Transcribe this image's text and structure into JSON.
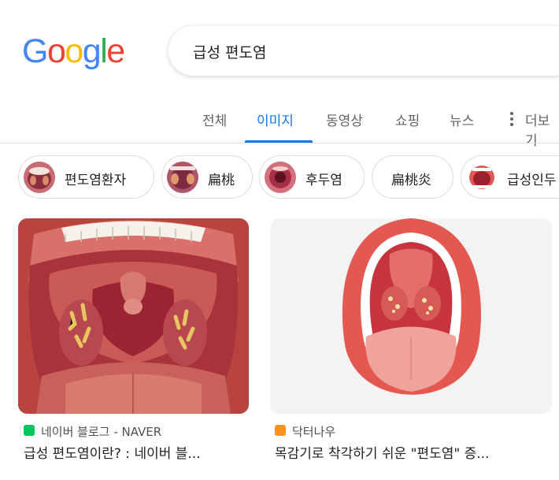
{
  "logo": {
    "letters": [
      "G",
      "o",
      "o",
      "g",
      "l",
      "e"
    ],
    "colors": [
      "#4285f4",
      "#ea4335",
      "#fbbc05",
      "#4285f4",
      "#34a853",
      "#ea4335"
    ]
  },
  "search": {
    "query": "급성 편도염"
  },
  "tabs": [
    {
      "label": "전체",
      "active": false
    },
    {
      "label": "이미지",
      "active": true
    },
    {
      "label": "동영상",
      "active": false
    },
    {
      "label": "쇼핑",
      "active": false
    },
    {
      "label": "뉴스",
      "active": false
    },
    {
      "label": "더보기",
      "active": false
    }
  ],
  "chips": [
    {
      "label": "편도염환자",
      "has_thumb": true
    },
    {
      "label": "扁桃",
      "has_thumb": true
    },
    {
      "label": "후두염",
      "has_thumb": true
    },
    {
      "label": "扁桃炎",
      "has_thumb": false
    },
    {
      "label": "급성인두",
      "has_thumb": true
    }
  ],
  "results": [
    {
      "source": "네이버 블로그 - NAVER",
      "source_icon": "naver-blog-icon",
      "source_color": "#03c75a",
      "title": "급성 편도염이란? : 네이버 블..."
    },
    {
      "source": "닥터나우",
      "source_icon": "doctornow-icon",
      "source_color": "#f7931e",
      "title": "목감기로 착각하기 쉬운 \"편도염\" 증..."
    }
  ],
  "colors": {
    "accent": "#1a73e8",
    "text_secondary": "#5f6368"
  }
}
